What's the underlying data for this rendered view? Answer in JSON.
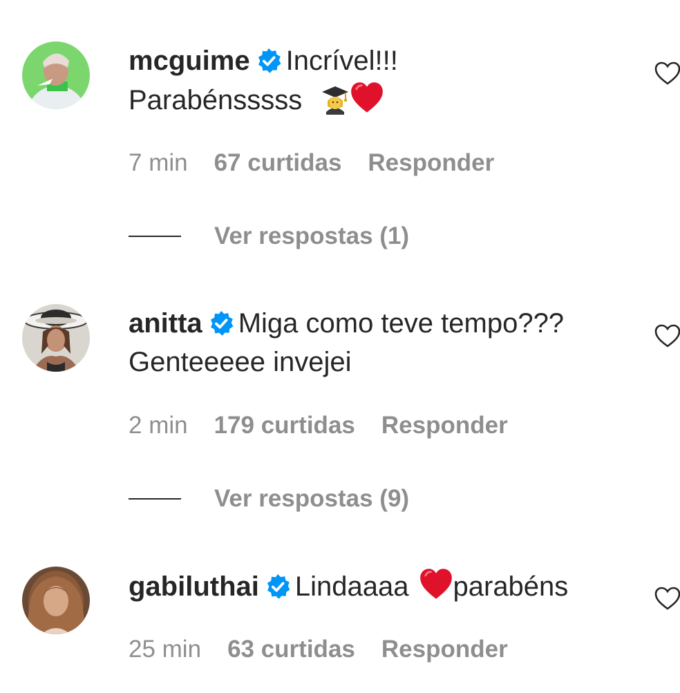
{
  "comments": [
    {
      "username": "mcguime",
      "text_line1": "Incrível!!!",
      "text_line2": "Parabénsssss",
      "emoji_icons": [
        "student-emoji",
        "red-heart-emoji"
      ],
      "time": "7 min",
      "likes": "67 curtidas",
      "reply_label": "Responder",
      "view_replies": "Ver respostas (1)"
    },
    {
      "username": "anitta",
      "text_line1": "Miga como teve tempo???",
      "text_line2": "Genteeeee invejei",
      "time": "2 min",
      "likes": "179 curtidas",
      "reply_label": "Responder",
      "view_replies": "Ver respostas (9)"
    },
    {
      "username": "gabiluthai",
      "text_before_emoji": "Lindaaaa",
      "text_after_emoji": "parabéns",
      "emoji_icons": [
        "red-heart-emoji"
      ],
      "time": "25 min",
      "likes": "63 curtidas",
      "reply_label": "Responder"
    }
  ],
  "colors": {
    "text": "#262626",
    "muted": "#8e8e8e",
    "verified": "#0095f6",
    "heart": "#e0112b"
  },
  "icons": {
    "verified": "verified-badge-icon",
    "like": "heart-outline-icon"
  }
}
